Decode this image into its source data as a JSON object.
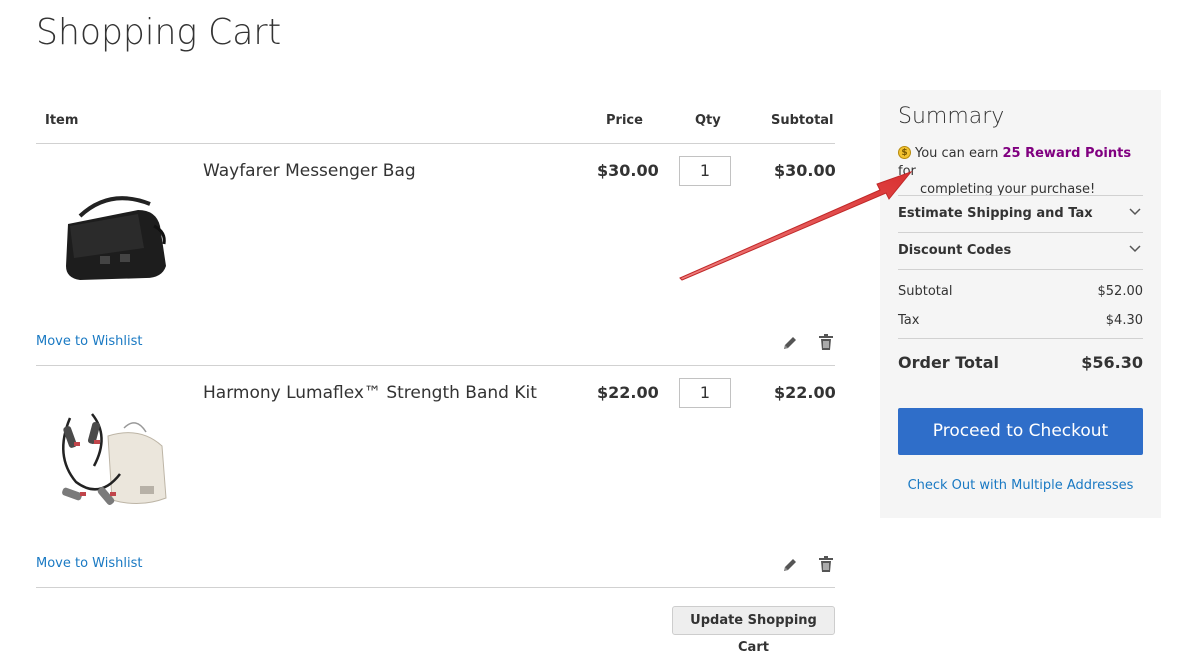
{
  "page": {
    "title": "Shopping Cart"
  },
  "cart": {
    "headers": {
      "item": "Item",
      "price": "Price",
      "qty": "Qty",
      "subtotal": "Subtotal"
    },
    "items": [
      {
        "name": "Wayfarer Messenger Bag",
        "price": "$30.00",
        "qty": "1",
        "subtotal": "$30.00",
        "wishlist_label": "Move to Wishlist"
      },
      {
        "name": "Harmony Lumaflex™ Strength Band Kit",
        "price": "$22.00",
        "qty": "1",
        "subtotal": "$22.00",
        "wishlist_label": "Move to Wishlist"
      }
    ],
    "update_label": "Update Shopping Cart"
  },
  "summary": {
    "title": "Summary",
    "reward": {
      "prefix": "You can earn ",
      "points": "25 Reward Points",
      "suffix": " for",
      "line2": "completing your purchase!"
    },
    "estimate_label": "Estimate Shipping and Tax",
    "discount_label": "Discount Codes",
    "subtotal_label": "Subtotal",
    "subtotal_value": "$52.00",
    "tax_label": "Tax",
    "tax_value": "$4.30",
    "order_total_label": "Order Total",
    "order_total_value": "$56.30",
    "checkout_label": "Proceed to Checkout",
    "multi_address_label": "Check Out with Multiple Addresses"
  },
  "colors": {
    "link": "#1979c3",
    "checkout_button": "#2f6ec9",
    "reward_points": "#800080",
    "annotation_arrow": "#d93030"
  }
}
